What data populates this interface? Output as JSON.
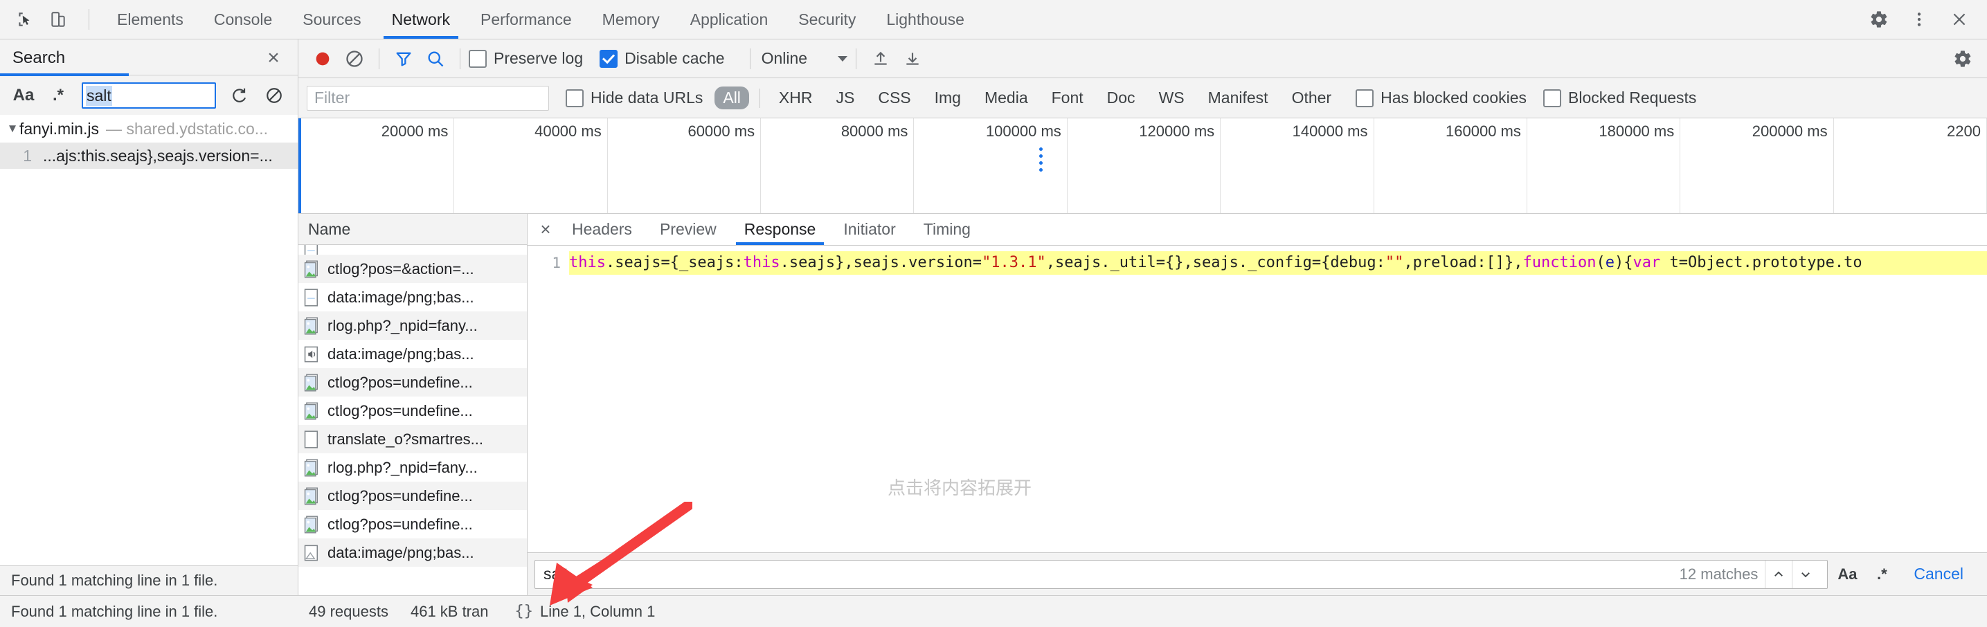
{
  "tabbar": {
    "inspect_icon": "inspect-cursor-icon",
    "device_icon": "device-toolbar-icon",
    "tabs": [
      {
        "label": "Elements",
        "active": false
      },
      {
        "label": "Console",
        "active": false
      },
      {
        "label": "Sources",
        "active": false
      },
      {
        "label": "Network",
        "active": true
      },
      {
        "label": "Performance",
        "active": false
      },
      {
        "label": "Memory",
        "active": false
      },
      {
        "label": "Application",
        "active": false
      },
      {
        "label": "Security",
        "active": false
      },
      {
        "label": "Lighthouse",
        "active": false
      }
    ],
    "settings_icon": "gear-icon",
    "more_icon": "kebab-menu-icon",
    "close_icon": "close-icon"
  },
  "search_panel": {
    "title": "Search",
    "close_label": "×",
    "match_case_label": "Aa",
    "regex_label": ".*",
    "query": "salt",
    "refresh_icon": "refresh-icon",
    "clear_icon": "clear-icon",
    "result_file": {
      "triangle": "▼",
      "name": "fanyi.min.js",
      "dash": "—",
      "url": "shared.ydstatic.co..."
    },
    "result_line": {
      "number": "1",
      "text": "...ajs:this.seajs},seajs.version=..."
    },
    "footer": "Found 1 matching line in 1 file."
  },
  "net_toolbar": {
    "record_icon": "record-button-icon",
    "clear_icon": "clear-requests-icon",
    "filter_icon": "filter-funnel-icon",
    "search_icon": "search-icon",
    "preserve_log": {
      "label": "Preserve log",
      "checked": false
    },
    "disable_cache": {
      "label": "Disable cache",
      "checked": true
    },
    "throttling": "Online",
    "import_icon": "import-har-icon",
    "export_icon": "export-har-icon",
    "settings_icon": "gear-icon"
  },
  "filter_row": {
    "filter_placeholder": "Filter",
    "hide_data_urls": {
      "label": "Hide data URLs",
      "checked": false
    },
    "types": [
      "All",
      "XHR",
      "JS",
      "CSS",
      "Img",
      "Media",
      "Font",
      "Doc",
      "WS",
      "Manifest",
      "Other"
    ],
    "active_type": "All",
    "has_blocked_cookies": {
      "label": "Has blocked cookies",
      "checked": false
    },
    "blocked_requests": {
      "label": "Blocked Requests",
      "checked": false
    }
  },
  "overview": {
    "ticks": [
      "20000 ms",
      "40000 ms",
      "60000 ms",
      "80000 ms",
      "100000 ms",
      "120000 ms",
      "140000 ms",
      "160000 ms",
      "180000 ms",
      "200000 ms",
      "2200"
    ]
  },
  "request_list": {
    "column_header": "Name",
    "rows": [
      {
        "name": "ctlog?pos=&action=...",
        "icon": "image-file-icon"
      },
      {
        "name": "data:image/png;bas...",
        "icon": "blank-file-icon"
      },
      {
        "name": "rlog.php?_npid=fany...",
        "icon": "image-file-icon"
      },
      {
        "name": "data:image/png;bas...",
        "icon": "media-file-icon"
      },
      {
        "name": "ctlog?pos=undefine...",
        "icon": "image-file-icon"
      },
      {
        "name": "ctlog?pos=undefine...",
        "icon": "image-file-icon"
      },
      {
        "name": "translate_o?smartres...",
        "icon": "blank-file-icon"
      },
      {
        "name": "rlog.php?_npid=fany...",
        "icon": "image-file-icon"
      },
      {
        "name": "ctlog?pos=undefine...",
        "icon": "image-file-icon"
      },
      {
        "name": "ctlog?pos=undefine...",
        "icon": "image-file-icon"
      },
      {
        "name": "data:image/png;bas...",
        "icon": "generic-image-icon"
      }
    ]
  },
  "detail": {
    "close_label": "×",
    "tabs": [
      {
        "label": "Headers",
        "active": false
      },
      {
        "label": "Preview",
        "active": false
      },
      {
        "label": "Response",
        "active": true
      },
      {
        "label": "Initiator",
        "active": false
      },
      {
        "label": "Timing",
        "active": false
      }
    ],
    "line_number": "1",
    "code_segments": [
      {
        "t": "this",
        "c": "k"
      },
      {
        "t": ".seajs={_seajs:",
        "c": ""
      },
      {
        "t": "this",
        "c": "k"
      },
      {
        "t": ".seajs},seajs.version=",
        "c": ""
      },
      {
        "t": "\"1.3.1\"",
        "c": "str"
      },
      {
        "t": ",seajs._util={},seajs._config={debug:",
        "c": ""
      },
      {
        "t": "\"\"",
        "c": "str"
      },
      {
        "t": ",preload:[]},",
        "c": ""
      },
      {
        "t": "function",
        "c": "k"
      },
      {
        "t": "(",
        "c": ""
      },
      {
        "t": "e",
        "c": "var"
      },
      {
        "t": "){",
        "c": ""
      },
      {
        "t": "var",
        "c": "k"
      },
      {
        "t": " t=Object.prototype.to",
        "c": ""
      }
    ],
    "watermark": "点击将内容拓展开"
  },
  "findbar": {
    "query": "salt",
    "matches": "12 matches",
    "prev_icon": "chevron-up-icon",
    "next_icon": "chevron-down-icon",
    "match_case_label": "Aa",
    "regex_label": ".*",
    "cancel_label": "Cancel"
  },
  "statusbar": {
    "requests": "49 requests",
    "transferred": "461 kB tran",
    "pretty_print": "{}",
    "cursor": "Line 1, Column 1"
  },
  "colors": {
    "accent": "#1a73e8",
    "record": "#d93025",
    "highlight": "#ffff99",
    "selection": "#c6dcf7",
    "arrow": "#f43e3e"
  }
}
